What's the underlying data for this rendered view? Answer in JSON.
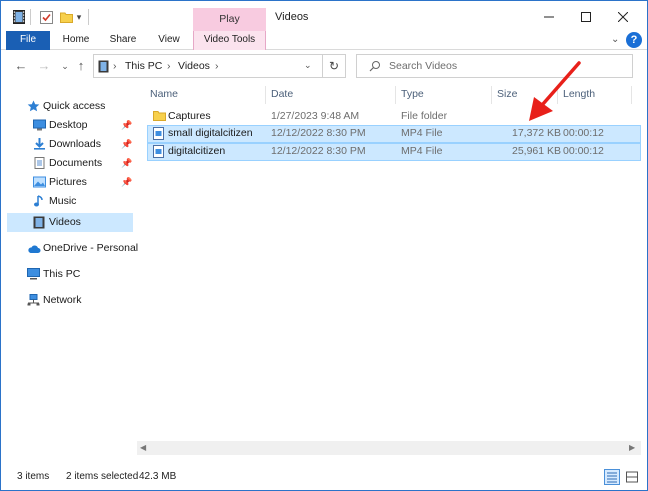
{
  "titlebar": {
    "title": "Videos",
    "context_tab": "Play",
    "minimize": "—",
    "maximize": "☐",
    "close": "✕"
  },
  "ribbon": {
    "tabs": [
      {
        "label": "File"
      },
      {
        "label": "Home"
      },
      {
        "label": "Share"
      },
      {
        "label": "View"
      },
      {
        "label": "Video Tools"
      }
    ],
    "help": "?"
  },
  "address": {
    "crumbs": [
      "This PC",
      "Videos"
    ],
    "search_placeholder": "Search Videos"
  },
  "nav": {
    "items": [
      {
        "label": "Quick access",
        "icon": "star-icon"
      },
      {
        "label": "Desktop",
        "icon": "desktop-icon",
        "pinned": true
      },
      {
        "label": "Downloads",
        "icon": "downloads-icon",
        "pinned": true
      },
      {
        "label": "Documents",
        "icon": "documents-icon",
        "pinned": true
      },
      {
        "label": "Pictures",
        "icon": "pictures-icon",
        "pinned": true
      },
      {
        "label": "Music",
        "icon": "music-icon"
      },
      {
        "label": "Videos",
        "icon": "videos-icon",
        "selected": true
      },
      {
        "label": "OneDrive - Personal",
        "icon": "cloud-icon"
      },
      {
        "label": "This PC",
        "icon": "computer-icon"
      },
      {
        "label": "Network",
        "icon": "network-icon"
      }
    ]
  },
  "columns": [
    "Name",
    "Date",
    "Type",
    "Size",
    "Length"
  ],
  "files": [
    {
      "name": "Captures",
      "date": "1/27/2023 9:48 AM",
      "type": "File folder",
      "size": "",
      "length": "",
      "selected": false,
      "icon": "folder-icon"
    },
    {
      "name": "small digitalcitizen",
      "date": "12/12/2022 8:30 PM",
      "type": "MP4 File",
      "size": "17,372 KB",
      "length": "00:00:12",
      "selected": true,
      "icon": "video-file-icon"
    },
    {
      "name": "digitalcitizen",
      "date": "12/12/2022 8:30 PM",
      "type": "MP4 File",
      "size": "25,961 KB",
      "length": "00:00:12",
      "selected": true,
      "icon": "video-file-icon"
    }
  ],
  "status": {
    "items": "3 items",
    "selected": "2 items selected",
    "size": "42.3 MB"
  },
  "colors": {
    "accent": "#1a5fb4",
    "selection": "#cce8ff",
    "context_tab": "#f8cbe0",
    "annotation": "#e8201a"
  }
}
